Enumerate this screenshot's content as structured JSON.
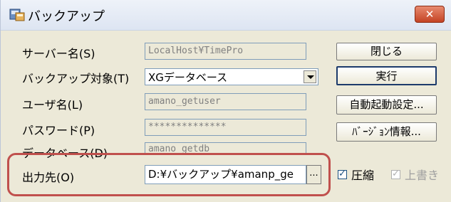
{
  "window": {
    "title": "バックアップ",
    "close_label": "✕"
  },
  "form": {
    "server": {
      "label": "サーバー名(S)",
      "value": "LocalHost¥TimePro"
    },
    "target": {
      "label": "バックアップ対象(T)",
      "value": "XGデータベース"
    },
    "user": {
      "label": "ユーザ名(L)",
      "value": "amano_getuser"
    },
    "password": {
      "label": "パスワード(P)",
      "value": "**************"
    },
    "database": {
      "label": "データベース(D)",
      "value": "amano_getdb"
    },
    "output": {
      "label": "出力先(O)",
      "value": "D:¥バックアップ¥amanp_ge",
      "browse_label": "..."
    }
  },
  "buttons": {
    "close": "閉じる",
    "run": "実行",
    "auto_start": "自動起動設定...",
    "version": "ﾊﾞｰｼﾞｮﾝ情報..."
  },
  "options": {
    "compress": {
      "label": "圧縮",
      "checked": true
    },
    "overwrite": {
      "label": "上書き",
      "checked": true,
      "disabled": true
    }
  },
  "colors": {
    "highlight": "#c0504d",
    "close_button": "#c44324"
  }
}
